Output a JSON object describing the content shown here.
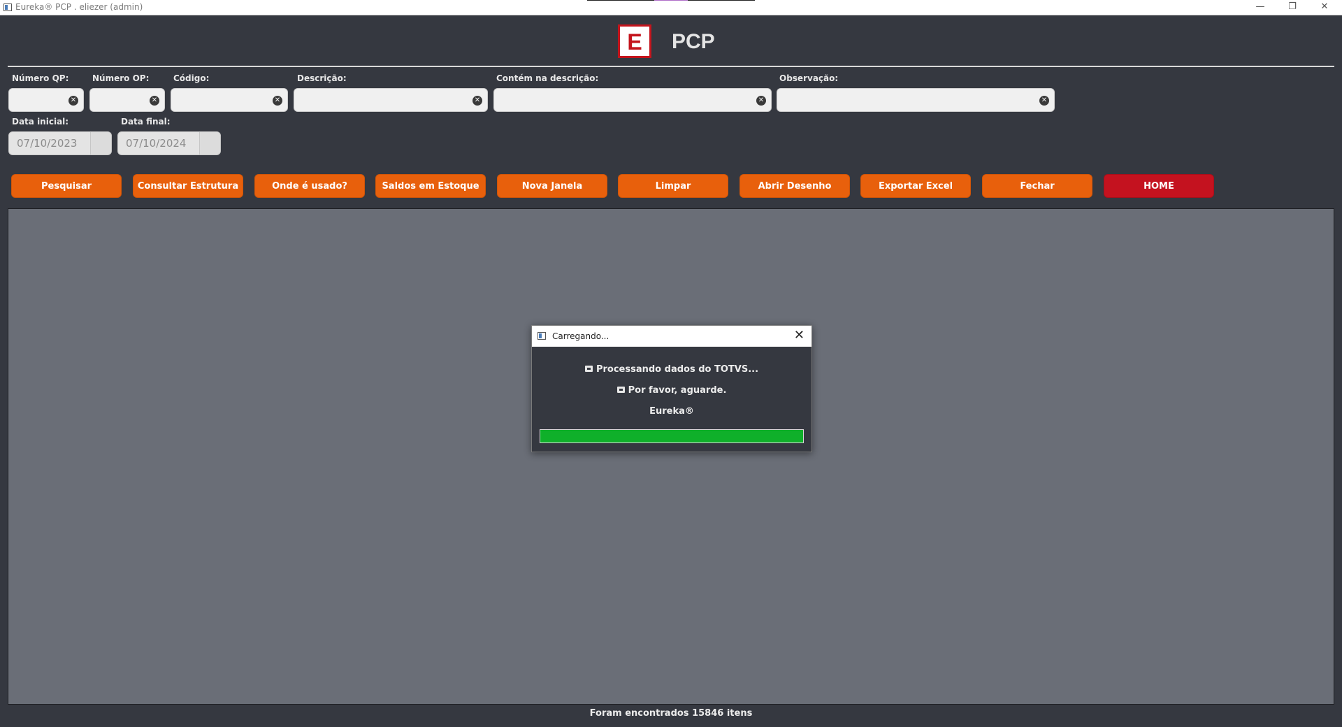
{
  "window": {
    "title": "Eureka® PCP . eliezer (admin)",
    "minimize_glyph": "—",
    "restore_glyph": "❐",
    "close_glyph": "✕"
  },
  "header": {
    "logo_letter": "E",
    "title": "PCP"
  },
  "filters": {
    "numero_qp": {
      "label": "Número QP:",
      "value": ""
    },
    "numero_op": {
      "label": "Número OP:",
      "value": ""
    },
    "codigo": {
      "label": "Código:",
      "value": ""
    },
    "descricao": {
      "label": "Descrição:",
      "value": ""
    },
    "contem_descricao": {
      "label": "Contém na descrição:",
      "value": ""
    },
    "observacao": {
      "label": "Observação:",
      "value": ""
    },
    "clear_glyph": "✕"
  },
  "dates": {
    "inicial": {
      "label": "Data inicial:",
      "value": "07/10/2023"
    },
    "final": {
      "label": "Data final:",
      "value": "07/10/2024"
    }
  },
  "toolbar": {
    "pesquisar": "Pesquisar",
    "consultar_estrutura": "Consultar Estrutura",
    "onde_usado": "Onde é usado?",
    "saldos_estoque": "Saldos em Estoque",
    "nova_janela": "Nova Janela",
    "limpar": "Limpar",
    "abrir_desenho": "Abrir Desenho",
    "exportar_excel": "Exportar Excel",
    "fechar": "Fechar",
    "home": "HOME"
  },
  "colors": {
    "button": "#e8600c",
    "home_button": "#c4121f",
    "background": "#353840",
    "results_area": "#6a6e77",
    "progress": "#0fb02a"
  },
  "status": {
    "text": "Foram encontrados 15846 itens"
  },
  "dialog": {
    "title": "Carregando...",
    "close_glyph": "✕",
    "line1": "Processando dados do TOTVS...",
    "line2": "Por favor, aguarde.",
    "line3": "Eureka®",
    "progress": 1.0
  }
}
